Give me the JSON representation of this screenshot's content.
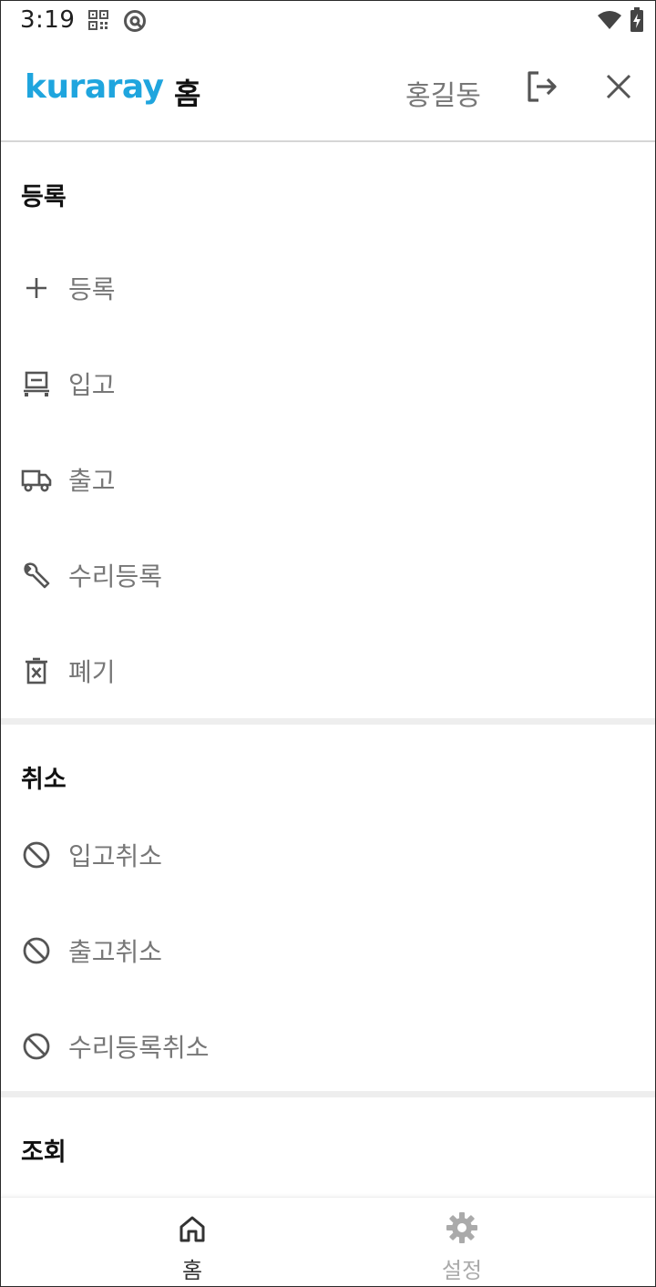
{
  "status_bar": {
    "time": "3:19"
  },
  "header": {
    "logo_text": "kuraray",
    "title": "홈",
    "user_name": "홍길동"
  },
  "sections": {
    "register": {
      "title": "등록",
      "items": [
        {
          "label": "등록",
          "icon": "plus-icon"
        },
        {
          "label": "입고",
          "icon": "warehouse-in-icon"
        },
        {
          "label": "출고",
          "icon": "truck-icon"
        },
        {
          "label": "수리등록",
          "icon": "wrench-icon"
        },
        {
          "label": "폐기",
          "icon": "trash-x-icon"
        }
      ]
    },
    "cancel": {
      "title": "취소",
      "items": [
        {
          "label": "입고취소",
          "icon": "block-icon"
        },
        {
          "label": "출고취소",
          "icon": "block-icon"
        },
        {
          "label": "수리등록취소",
          "icon": "block-icon"
        }
      ]
    },
    "inquiry": {
      "title": "조회"
    }
  },
  "bottom_nav": {
    "home_label": "홈",
    "settings_label": "설정"
  },
  "colors": {
    "brand": "#1fa5de",
    "icon": "#555555",
    "label": "#777777",
    "active_nav": "#333333",
    "inactive_nav": "#aaaaaa"
  }
}
